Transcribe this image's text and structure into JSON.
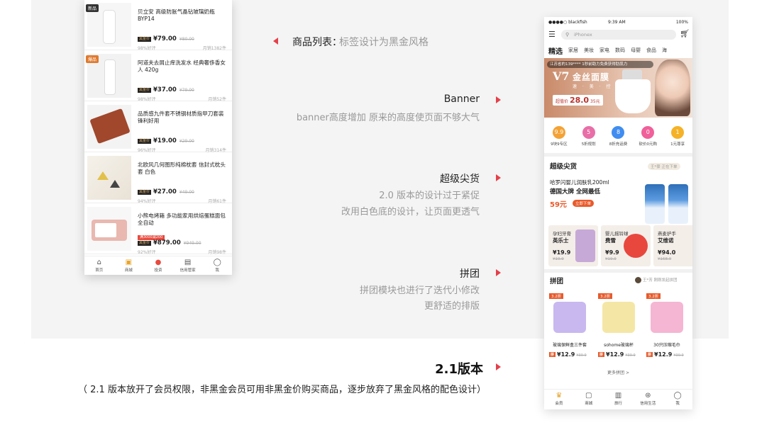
{
  "left_phone": {
    "products": [
      {
        "tag": "新品",
        "title": "贝立安 高级防胀气晶钻玻璃奶瓶 BYP14",
        "price": "¥79.00",
        "old": "¥80.00",
        "rate": "98%好评",
        "sold": "月销1382件"
      },
      {
        "tag": "爆品",
        "title": "阿道夫去屑止痒洗发水 经典奢侈香女人 420g",
        "price": "¥37.00",
        "old": "¥79.00",
        "rate": "98%好评",
        "sold": "月销52件"
      },
      {
        "tag": "",
        "title": "品质感九件套不锈钢材质指甲刀套装 锋利好用",
        "price": "¥19.00",
        "old": "¥29.00",
        "rate": "96%好评",
        "sold": "月销314件"
      },
      {
        "tag": "",
        "title": "北欧风几何图形纯棉枕套 信封式枕头套 白色",
        "price": "¥27.00",
        "old": "¥49.00",
        "rate": "94%好评",
        "sold": "月销61件"
      },
      {
        "tag": "",
        "title": "小熊电烤箱 多功能家用烘焙蛋糕面包全自动",
        "price": "¥879.00",
        "old": "¥949.00",
        "rate": "92%好评",
        "sold": "月销98件",
        "promo": "满3000减200"
      }
    ],
    "black_badge": "黑金价",
    "tabs": [
      {
        "icon": "home-icon",
        "label": "首页"
      },
      {
        "icon": "bag-icon",
        "label": "商城"
      },
      {
        "icon": "invest-icon",
        "label": "投资"
      },
      {
        "icon": "card-icon",
        "label": "信用管家"
      },
      {
        "icon": "user-icon",
        "label": "我"
      }
    ]
  },
  "annotations": {
    "list_title": "商品列表：",
    "list_desc": "标签设计为黑金风格",
    "banner_title": "Banner",
    "banner_desc": "banner高度增加 原来的高度使页面不够大气",
    "deal_title": "超级尖货",
    "deal_desc1": "2.0 版本的设计过于紧促",
    "deal_desc2": "改用白色底的设计，让页面更透气",
    "group_title": "拼团",
    "group_desc1": "拼团模块也进行了迭代小修改",
    "group_desc2": "更舒适的排版",
    "version": "2.1版本",
    "footnote": "（ 2.1 版本放开了会员权限，非黑金会员可用非黑金价购买商品，逐步放弃了黑金风格的配色设计）"
  },
  "right_phone": {
    "status": {
      "carrier": "●●●●○ blackfish",
      "time": "9:39 AM",
      "battery": "100%"
    },
    "search_placeholder": "iPhonex",
    "categories": [
      "精选",
      "家居",
      "美妆",
      "家电",
      "数码",
      "母婴",
      "食品",
      "海"
    ],
    "banner": {
      "notice": "江苏省的139**** 1秒前助力免费获得肋肌力",
      "v7": "V7",
      "headline": "金丝面膜",
      "sub": "速 · 美 · 控 · 嫩",
      "price_label": "超值价",
      "price": "28.0",
      "price_old": "35元"
    },
    "icons": [
      {
        "label": "9块9专区",
        "color": "#f4a235",
        "glyph": "9.9"
      },
      {
        "label": "5折规划",
        "color": "#e86ea8",
        "glyph": "5"
      },
      {
        "label": "8折充话费",
        "color": "#3f8df0",
        "glyph": "8"
      },
      {
        "label": "砍价0元购",
        "color": "#f0609a",
        "glyph": "0"
      },
      {
        "label": "1元尊享",
        "color": "#f5b227",
        "glyph": "1"
      }
    ],
    "deal": {
      "title": "超级尖货",
      "right": "王*豪 正在下单",
      "name": "哈罗闪婴儿润肤乳200ml",
      "sub": "德国大牌 全网最低",
      "price": "59元",
      "cta": "立即下单",
      "minis": [
        {
          "t1": "孕妇牙膏",
          "t2": "英乐士",
          "p": "¥19.9",
          "op": "¥19.9",
          "color": "#c7a9d8"
        },
        {
          "t1": "婴儿摇铃球",
          "t2": "费雪",
          "p": "¥9.9",
          "op": "¥19.9",
          "color": "#e8473e"
        },
        {
          "t1": "燕麦护手",
          "t2": "艾维诺",
          "p": "¥94.0",
          "op": "¥168.0",
          "color": "#dfe5ea"
        }
      ]
    },
    "group": {
      "title": "拼团",
      "right": "王*芳 刚刚发起拼团",
      "items": [
        {
          "disc": "3.2折",
          "name": "玻璃保鲜盒三件套",
          "price": "12.9",
          "old": "¥39.9",
          "color": "#c8b8ef"
        },
        {
          "disc": "3.2折",
          "name": "sohome玻璃杯",
          "price": "12.9",
          "old": "¥39.9",
          "color": "#f4e7a6"
        },
        {
          "disc": "3.2折",
          "name": "30只压缩毛巾",
          "price": "12.9",
          "old": "¥39.9",
          "color": "#f5b6d3"
        }
      ],
      "tag": "拼",
      "more": "更多拼团 >"
    },
    "tabs": [
      {
        "icon": "crown-icon",
        "label": "会员"
      },
      {
        "icon": "bag-icon",
        "label": "商城"
      },
      {
        "icon": "travel-icon",
        "label": "旅行"
      },
      {
        "icon": "life-icon",
        "label": "信用生活"
      },
      {
        "icon": "user-icon",
        "label": "我"
      }
    ]
  }
}
